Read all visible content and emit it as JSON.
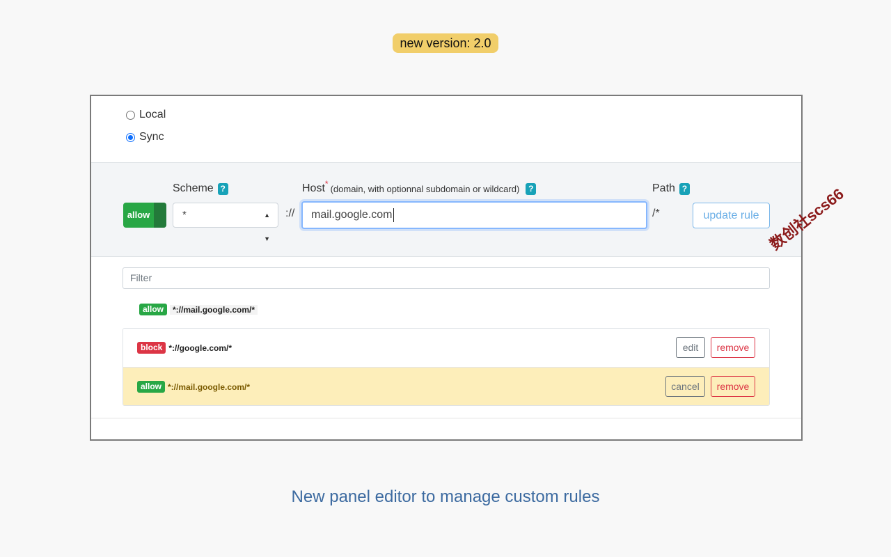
{
  "version_badge": "new version: 2.0",
  "storage": {
    "options": [
      {
        "label": "Local",
        "checked": false
      },
      {
        "label": "Sync",
        "checked": true
      }
    ]
  },
  "editor": {
    "toggle_label": "allow",
    "scheme_label": "Scheme",
    "scheme_value": "*",
    "scheme_separator": "://",
    "host_label": "Host",
    "host_required_mark": "*",
    "host_hint": "(domain, with optionnal subdomain or wildcard)",
    "host_value": "mail.google.com",
    "path_label": "Path",
    "path_value": "/*",
    "help_glyph": "?",
    "update_button": "update rule"
  },
  "filter_placeholder": "Filter",
  "preview": {
    "badge": "allow",
    "rule": "*://mail.google.com/*"
  },
  "rules": [
    {
      "badge": "block",
      "rule": "*://google.com/*",
      "action": "edit",
      "remove": "remove"
    },
    {
      "badge": "allow",
      "rule": "*://mail.google.com/*",
      "action": "cancel",
      "remove": "remove"
    }
  ],
  "caption": "New panel editor to manage custom rules",
  "watermark": "数创社scs66",
  "colors": {
    "allow": "#28a745",
    "block": "#dc3545",
    "editing_row": "#fdeeba",
    "help": "#17a2b8",
    "badge_bg": "#f1ce6a",
    "caption": "#3c6aa0"
  }
}
